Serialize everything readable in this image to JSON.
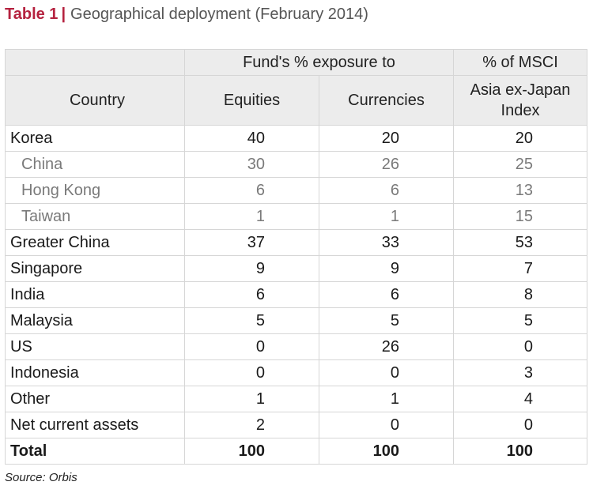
{
  "title": {
    "label": "Table 1",
    "separator": "|",
    "text": "Geographical deployment (February 2014)"
  },
  "header": {
    "group_label": "Fund's % exposure to",
    "msci_top": "% of MSCI",
    "msci_bottom": "Asia ex-Japan\nIndex",
    "country": "Country",
    "equities": "Equities",
    "currencies": "Currencies"
  },
  "rows": [
    {
      "country": "Korea",
      "equities": "40",
      "currencies": "20",
      "msci": "20",
      "sub": false,
      "total": false
    },
    {
      "country": "China",
      "equities": "30",
      "currencies": "26",
      "msci": "25",
      "sub": true,
      "total": false
    },
    {
      "country": "Hong Kong",
      "equities": "6",
      "currencies": "6",
      "msci": "13",
      "sub": true,
      "total": false
    },
    {
      "country": "Taiwan",
      "equities": "1",
      "currencies": "1",
      "msci": "15",
      "sub": true,
      "total": false
    },
    {
      "country": "Greater China",
      "equities": "37",
      "currencies": "33",
      "msci": "53",
      "sub": false,
      "total": false
    },
    {
      "country": "Singapore",
      "equities": "9",
      "currencies": "9",
      "msci": "7",
      "sub": false,
      "total": false
    },
    {
      "country": "India",
      "equities": "6",
      "currencies": "6",
      "msci": "8",
      "sub": false,
      "total": false
    },
    {
      "country": "Malaysia",
      "equities": "5",
      "currencies": "5",
      "msci": "5",
      "sub": false,
      "total": false
    },
    {
      "country": "US",
      "equities": "0",
      "currencies": "26",
      "msci": "0",
      "sub": false,
      "total": false
    },
    {
      "country": "Indonesia",
      "equities": "0",
      "currencies": "0",
      "msci": "3",
      "sub": false,
      "total": false
    },
    {
      "country": "Other",
      "equities": "1",
      "currencies": "1",
      "msci": "4",
      "sub": false,
      "total": false
    },
    {
      "country": "Net current assets",
      "equities": "2",
      "currencies": "0",
      "msci": "0",
      "sub": false,
      "total": false
    },
    {
      "country": "Total",
      "equities": "100",
      "currencies": "100",
      "msci": "100",
      "sub": false,
      "total": true
    }
  ],
  "source": "Source: Orbis",
  "colors": {
    "title_accent": "#b5223f",
    "title_text": "#555555",
    "header_bg": "#ececec",
    "border": "#d6d6d6",
    "sub_row_text": "#7a7a7a"
  }
}
